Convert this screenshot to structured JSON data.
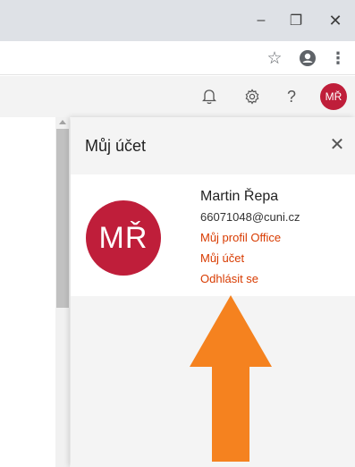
{
  "window_controls": {
    "minimize": "–",
    "restore": "❐",
    "close": "✕"
  },
  "toolbar": {
    "star": "☆",
    "more": "⋮"
  },
  "appbar": {
    "help": "?",
    "avatar_initials": "MŘ"
  },
  "panel": {
    "title": "Můj účet",
    "close": "✕",
    "avatar_initials": "MŘ",
    "user_name": "Martin Řepa",
    "user_email": "66071048@cuni.cz",
    "links": [
      "Můj profil Office",
      "Můj účet",
      "Odhlásit se"
    ]
  },
  "colors": {
    "accent_link": "#d83b01",
    "avatar_bg": "#bf1e3a",
    "annotation_arrow": "#f5821f"
  },
  "icons": [
    "bell-icon",
    "gear-icon",
    "help-icon",
    "star-icon",
    "account-icon",
    "more-icon",
    "up-arrow-annotation"
  ]
}
